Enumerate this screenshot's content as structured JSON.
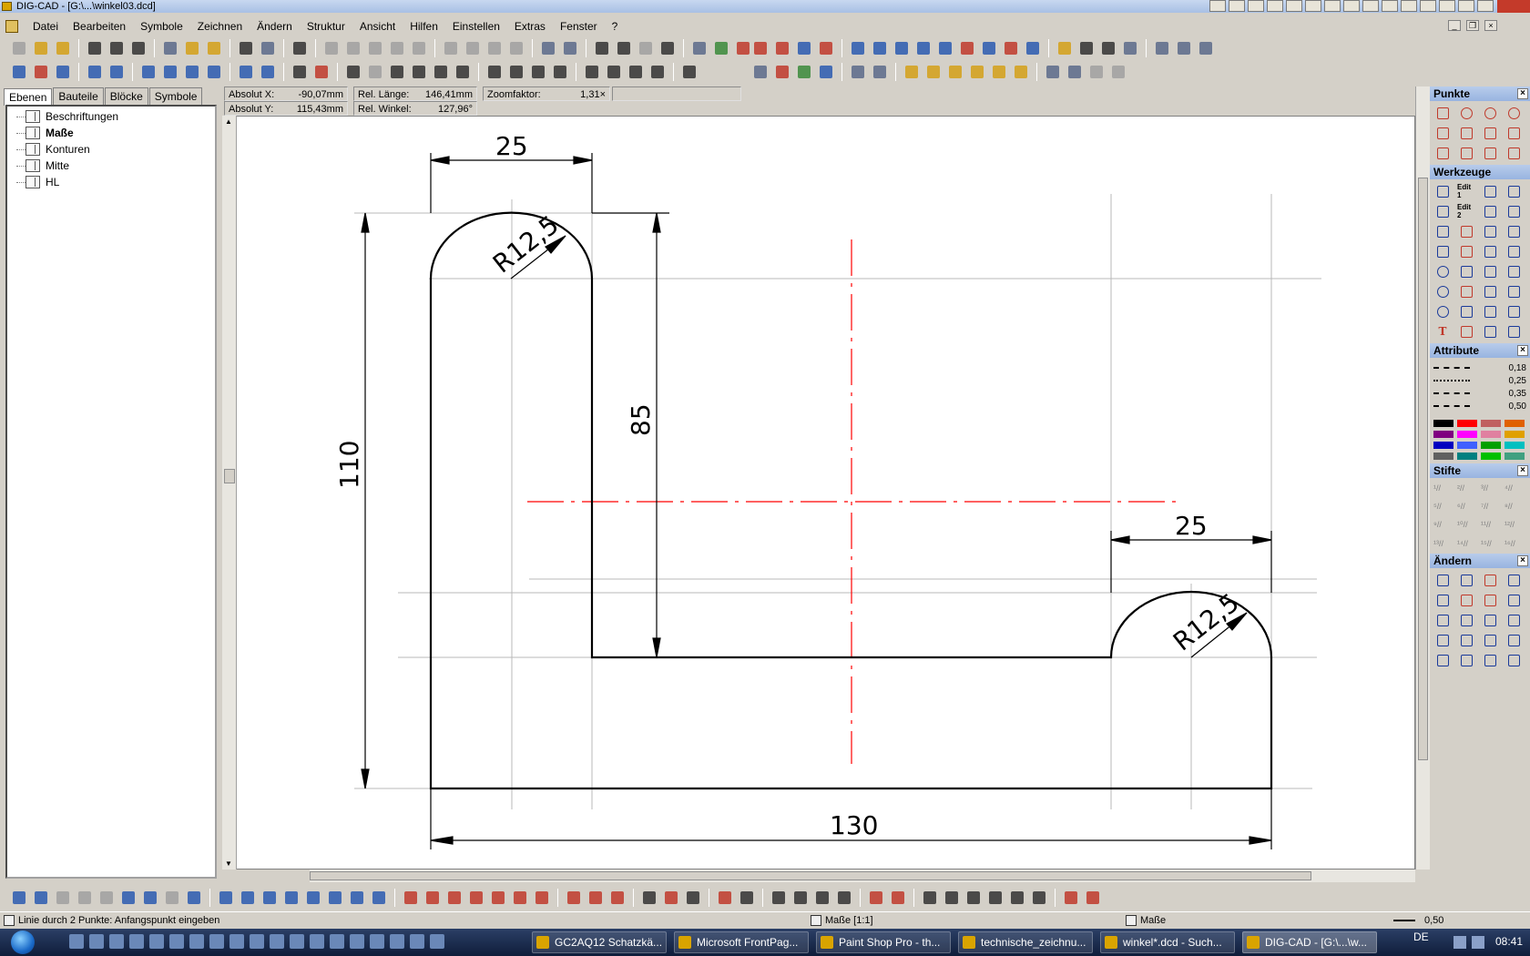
{
  "window": {
    "title": "DIG-CAD - [G:\\...\\winkel03.dcd]"
  },
  "menu": [
    "Datei",
    "Bearbeiten",
    "Symbole",
    "Zeichnen",
    "Ändern",
    "Struktur",
    "Ansicht",
    "Hilfen",
    "Einstellen",
    "Extras",
    "Fenster",
    "?"
  ],
  "left_tabs": [
    "Ebenen",
    "Bauteile",
    "Blöcke",
    "Symbole"
  ],
  "layers": [
    {
      "label": "Beschriftungen",
      "active": false
    },
    {
      "label": "Maße",
      "active": true
    },
    {
      "label": "Konturen",
      "active": false
    },
    {
      "label": "Mitte",
      "active": false
    },
    {
      "label": "HL",
      "active": false
    }
  ],
  "info": {
    "abs_x_label": "Absolut X:",
    "abs_x": "-90,07mm",
    "abs_y_label": "Absolut Y:",
    "abs_y": "115,43mm",
    "rel_len_label": "Rel. Länge:",
    "rel_len": "146,41mm",
    "rel_angle_label": "Rel. Winkel:",
    "rel_angle": "127,96°",
    "zoom_label": "Zoomfaktor:",
    "zoom": "1,31×"
  },
  "drawing": {
    "dim_top_left": "25",
    "dim_left_height": "110",
    "dim_inner_height": "85",
    "dim_right_top": "25",
    "dim_bottom": "130",
    "radius_left": "R12,5",
    "radius_right": "R12,5"
  },
  "palettes": {
    "punkte": "Punkte",
    "werkzeuge": "Werkzeuge",
    "attribute": "Attribute",
    "stifte": "Stifte",
    "aendern": "Ändern",
    "line_widths": [
      "0,18",
      "0,25",
      "0,35",
      "0,50"
    ],
    "edit1": "Edit 1",
    "edit2": "Edit 2"
  },
  "colors": {
    "contour": "#000000",
    "center_line": "#ff0000",
    "construction": "#b0b0b0",
    "swatches": [
      "#000000",
      "#ff0000",
      "#c06060",
      "#e06000",
      "#800080",
      "#ff00ff",
      "#e080a0",
      "#e0a000",
      "#0000c0",
      "#4060ff",
      "#00a000",
      "#00c0c0",
      "#606060",
      "#008080",
      "#00c000",
      "#40a080"
    ]
  },
  "status": {
    "hint": "Linie durch 2 Punkte: Anfangspunkt eingeben",
    "layer": "Maße [1:1]",
    "layer2": "Maße",
    "line_width": "0,50"
  },
  "taskbar": {
    "tasks": [
      {
        "label": "GC2AQ12 Schatzkä...",
        "active": false
      },
      {
        "label": "Microsoft FrontPag...",
        "active": false
      },
      {
        "label": "Paint Shop Pro - th...",
        "active": false
      },
      {
        "label": "technische_zeichnu...",
        "active": false
      },
      {
        "label": "winkel*.dcd - Such...",
        "active": false
      },
      {
        "label": "DIG-CAD - [G:\\...\\w...",
        "active": true
      }
    ],
    "lang": "DE",
    "clock": "08:41"
  }
}
